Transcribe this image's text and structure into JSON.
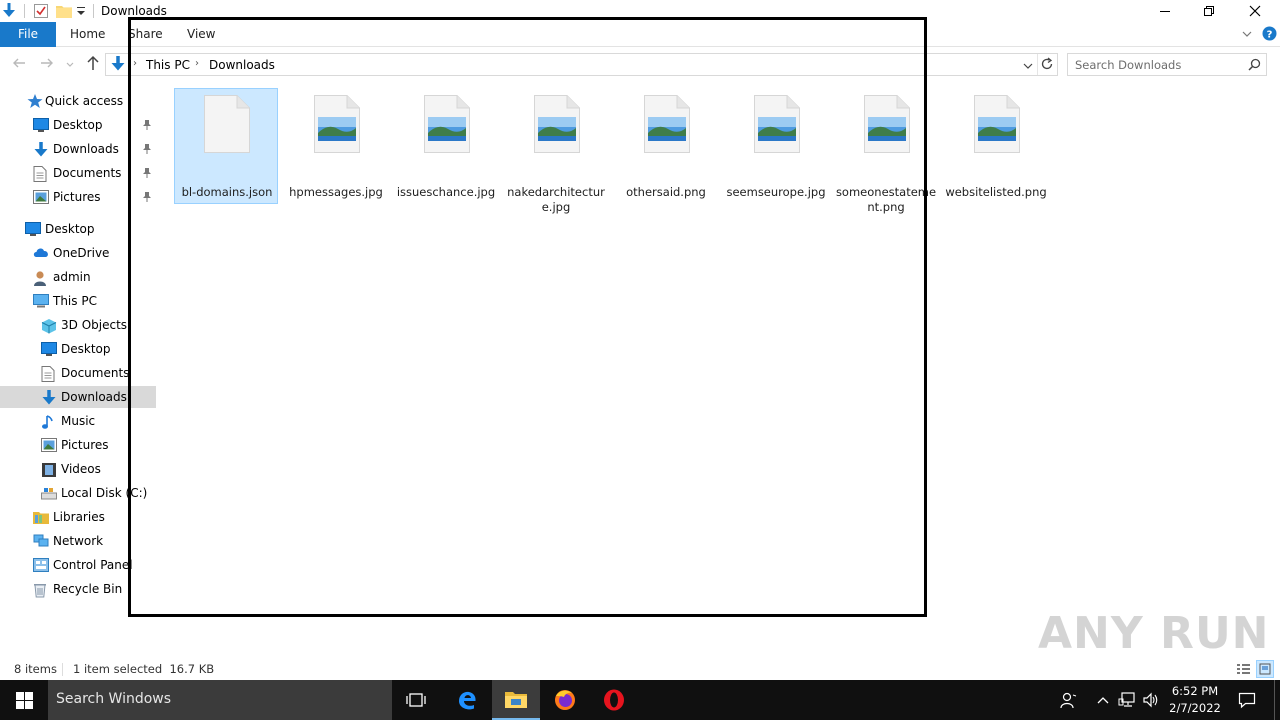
{
  "window": {
    "title": "Downloads"
  },
  "ribbon": {
    "tabs": [
      "File",
      "Home",
      "Share",
      "View"
    ]
  },
  "address": {
    "crumbs": [
      "This PC",
      "Downloads"
    ]
  },
  "search": {
    "placeholder": "Search Downloads"
  },
  "nav": {
    "items": [
      {
        "label": "Quick access",
        "icon": "star-icon"
      },
      {
        "label": "Desktop",
        "icon": "desktop-icon"
      },
      {
        "label": "Downloads",
        "icon": "download-arrow-icon"
      },
      {
        "label": "Documents",
        "icon": "document-icon"
      },
      {
        "label": "Pictures",
        "icon": "pictures-icon"
      },
      {
        "label": "Desktop",
        "icon": "desktop-icon"
      },
      {
        "label": "OneDrive",
        "icon": "cloud-icon"
      },
      {
        "label": "admin",
        "icon": "user-icon"
      },
      {
        "label": "This PC",
        "icon": "computer-icon"
      },
      {
        "label": "3D Objects",
        "icon": "cube-icon"
      },
      {
        "label": "Desktop",
        "icon": "desktop-icon"
      },
      {
        "label": "Documents",
        "icon": "document-icon"
      },
      {
        "label": "Downloads",
        "icon": "download-arrow-icon"
      },
      {
        "label": "Music",
        "icon": "music-note-icon"
      },
      {
        "label": "Pictures",
        "icon": "pictures-icon"
      },
      {
        "label": "Videos",
        "icon": "film-icon"
      },
      {
        "label": "Local Disk (C:)",
        "icon": "drive-icon"
      },
      {
        "label": "Libraries",
        "icon": "library-icon"
      },
      {
        "label": "Network",
        "icon": "network-icon"
      },
      {
        "label": "Control Panel",
        "icon": "control-panel-icon"
      },
      {
        "label": "Recycle Bin",
        "icon": "recycle-bin-icon"
      }
    ]
  },
  "files": [
    {
      "name": "bl-domains.json",
      "type": "blank",
      "selected": true
    },
    {
      "name": "hpmessages.jpg",
      "type": "image",
      "selected": false
    },
    {
      "name": "issueschance.jpg",
      "type": "image",
      "selected": false
    },
    {
      "name": "nakedarchitecture.jpg",
      "type": "image",
      "selected": false
    },
    {
      "name": "othersaid.png",
      "type": "image",
      "selected": false
    },
    {
      "name": "seemseurope.jpg",
      "type": "image",
      "selected": false
    },
    {
      "name": "someonestatement.png",
      "type": "image",
      "selected": false
    },
    {
      "name": "websitelisted.png",
      "type": "image",
      "selected": false
    }
  ],
  "status": {
    "count": "8 items",
    "selection": "1 item selected  16.7 KB"
  },
  "taskbar": {
    "search_placeholder": "Search Windows",
    "time": "6:52 PM",
    "date": "2/7/2022"
  },
  "watermark": "ANY RUN",
  "colors": {
    "accent": "#1979ca",
    "selection_bg": "#cce8ff",
    "selection_border": "#99d1ff",
    "nav_selected": "#d9d9d9"
  }
}
